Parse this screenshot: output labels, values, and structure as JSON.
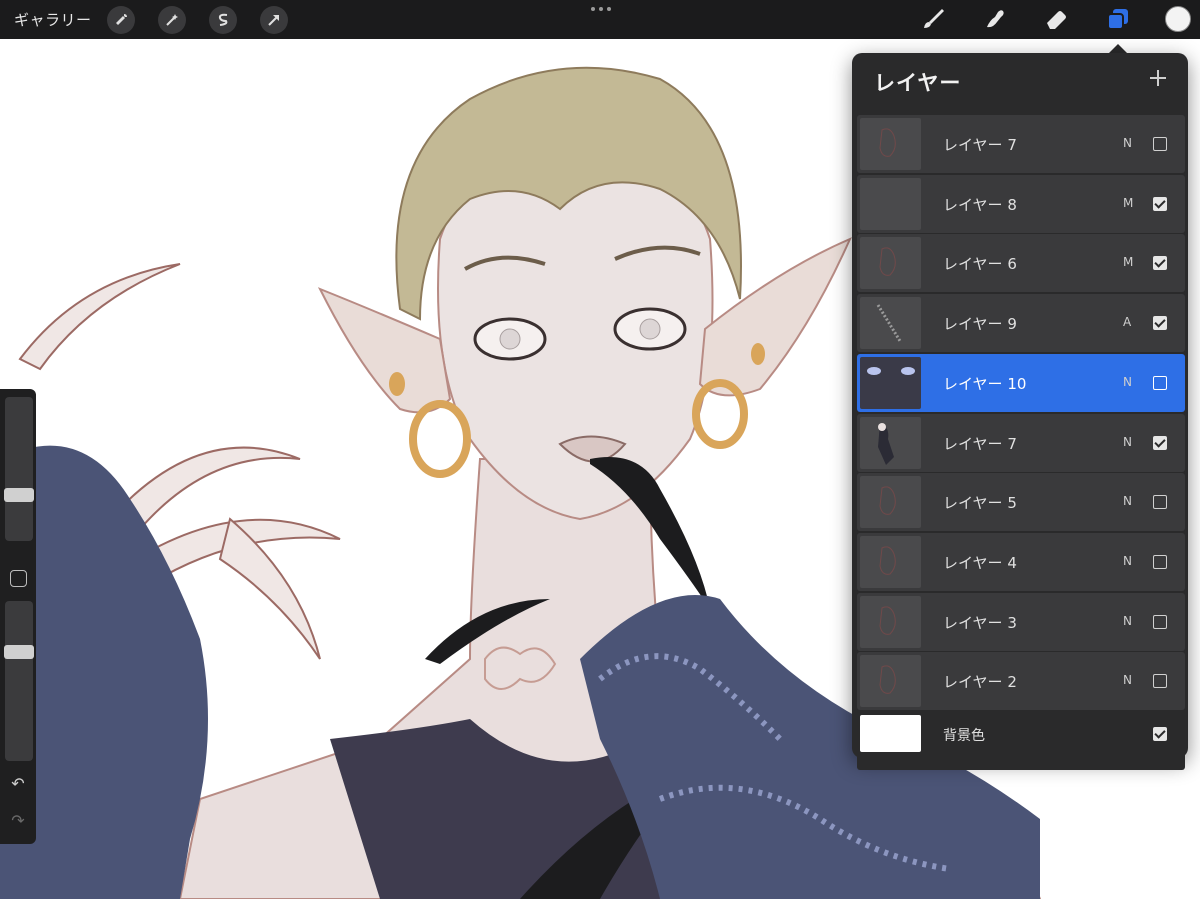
{
  "topbar": {
    "gallery_label": "ギャラリー",
    "left_tools": [
      {
        "icon": "wrench-icon"
      },
      {
        "icon": "magic-wand-icon"
      },
      {
        "icon": "selection-s-icon"
      },
      {
        "icon": "transform-arrow-icon"
      }
    ],
    "right_tools": [
      {
        "icon": "brush-icon"
      },
      {
        "icon": "smudge-icon"
      },
      {
        "icon": "eraser-icon"
      },
      {
        "icon": "layers-icon"
      }
    ],
    "active_color": "#f3f3f3",
    "layers_accent": "#2e6fe6"
  },
  "sidebar": {
    "brush_size_level": 0.3,
    "opacity_level": 0.7
  },
  "layers_panel": {
    "title": "レイヤー",
    "add_icon": "plus-icon",
    "layers": [
      {
        "name": "レイヤー 7",
        "mode": "N",
        "visible": false,
        "selected": false
      },
      {
        "name": "レイヤー 8",
        "mode": "M",
        "visible": true,
        "selected": false
      },
      {
        "name": "レイヤー 6",
        "mode": "M",
        "visible": true,
        "selected": false
      },
      {
        "name": "レイヤー 9",
        "mode": "A",
        "visible": true,
        "selected": false
      },
      {
        "name": "レイヤー 10",
        "mode": "N",
        "visible": false,
        "selected": true
      },
      {
        "name": "レイヤー 7",
        "mode": "N",
        "visible": true,
        "selected": false
      },
      {
        "name": "レイヤー 5",
        "mode": "N",
        "visible": false,
        "selected": false
      },
      {
        "name": "レイヤー 4",
        "mode": "N",
        "visible": false,
        "selected": false
      },
      {
        "name": "レイヤー 3",
        "mode": "N",
        "visible": false,
        "selected": false
      },
      {
        "name": "レイヤー 2",
        "mode": "N",
        "visible": false,
        "selected": false
      }
    ],
    "background": {
      "name": "背景色",
      "visible": true
    }
  }
}
